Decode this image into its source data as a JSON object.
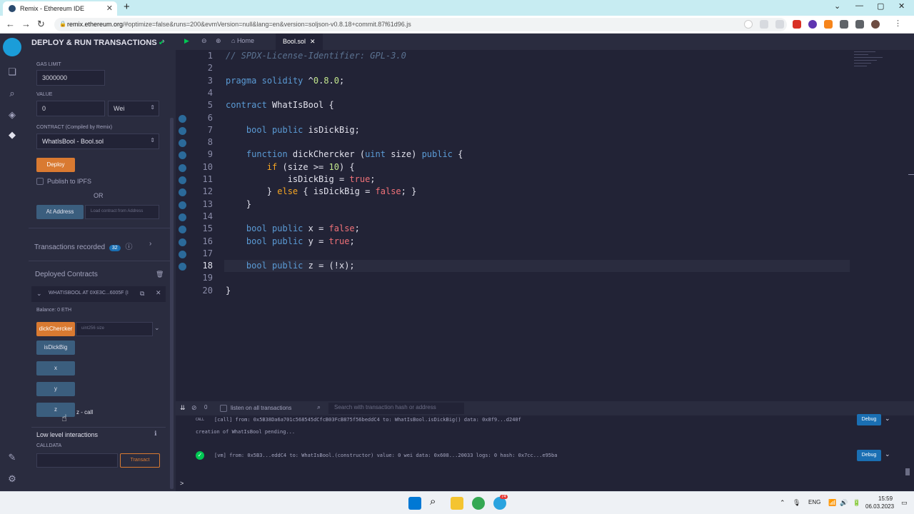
{
  "browser": {
    "tab_title": "Remix - Ethereum IDE",
    "tab_close": "✕",
    "new_tab": "+",
    "window_controls": [
      "⌄",
      "—",
      "▢",
      "✕"
    ],
    "url_host": "remix.ethereum.org",
    "url_rest": "/#optimize=false&runs=200&evmVersion=null&lang=en&version=soljson-v0.8.18+commit.87f61d96.js"
  },
  "iconbar": {
    "icons": [
      "file-explorer-icon",
      "search-icon",
      "compiler-icon",
      "deploy-icon",
      "plugin-icon",
      "settings-icon"
    ]
  },
  "panel": {
    "title": "DEPLOY & RUN TRANSACTIONS",
    "title_check": "✔",
    "gas_limit_label": "GAS LIMIT",
    "gas_limit_value": "3000000",
    "value_label": "VALUE",
    "value_amount": "0",
    "value_unit": "Wei",
    "contract_label": "CONTRACT",
    "contract_label_sub": "(Compiled by Remix)",
    "contract_selected": "WhatIsBool - Bool.sol",
    "deploy_label": "Deploy",
    "publish_ipfs": "Publish to IPFS",
    "or_label": "OR",
    "at_address": "At Address",
    "load_contract_placeholder": "Load contract from Address",
    "transactions_recorded": "Transactions recorded",
    "transactions_count": "32",
    "deployed_contracts": "Deployed Contracts",
    "instance_name": "WHATISBOOL AT 0XE3C...6005F (I",
    "balance": "Balance: 0 ETH",
    "fn_dickChercker": "dickChercker",
    "fn_dickChercker_placeholder": "uint256 size",
    "fn_isDickBig": "isDickBig",
    "fn_x": "x",
    "fn_y": "y",
    "fn_z": "z",
    "z_result": "z - call",
    "low_level": "Low level interactions",
    "calldata": "CALLDATA",
    "transact": "Transact"
  },
  "editor": {
    "tab_home": "Home",
    "tab_file": "Bool.sol",
    "lines": [
      "// SPDX-License-Identifier: GPL-3.0",
      "",
      "pragma solidity ^0.8.0;",
      "",
      "contract WhatIsBool {",
      "",
      "    bool public isDickBig;",
      "",
      "    function dickChercker (uint size) public {",
      "        if (size >= 10) {",
      "            isDickBig = true;",
      "        } else { isDickBig = false; }",
      "    }",
      "",
      "    bool public x = false;",
      "    bool public y = true;",
      "",
      "    bool public z = (!x);",
      "",
      "}"
    ],
    "line_numbers": [
      "1",
      "2",
      "3",
      "4",
      "5",
      "6",
      "7",
      "8",
      "9",
      "10",
      "11",
      "12",
      "13",
      "14",
      "15",
      "16",
      "17",
      "18",
      "19",
      "20"
    ],
    "current_line": 18
  },
  "terminal": {
    "count": "0",
    "listen_label": "listen on all transactions",
    "search_placeholder": "Search with transaction hash or address",
    "log1_tag": "CALL",
    "log1": "[call]  from: 0x5B38Da6a701c568545dCfcB03FcB875f56beddC4 to: WhatIsBool.isDickBig() data: 0x8f9...d240f",
    "log2": "creation of WhatIsBool pending...",
    "log3": "[vm]  from: 0x5B3...eddC4 to: WhatIsBool.(constructor) value: 0 wei data: 0x608...20033 logs: 0 hash: 0x7cc...e95ba",
    "debug": "Debug",
    "prompt": ">"
  },
  "taskbar": {
    "lang": "ENG",
    "time": "15:59",
    "date": "06.03.2023",
    "telegram_badge": "74"
  },
  "colors": {
    "accent_orange": "#d97a31",
    "accent_blue": "#1a6fb3",
    "keyword": "#5b9bd5",
    "string_lit": "#f07178",
    "comment": "#5b7291"
  }
}
